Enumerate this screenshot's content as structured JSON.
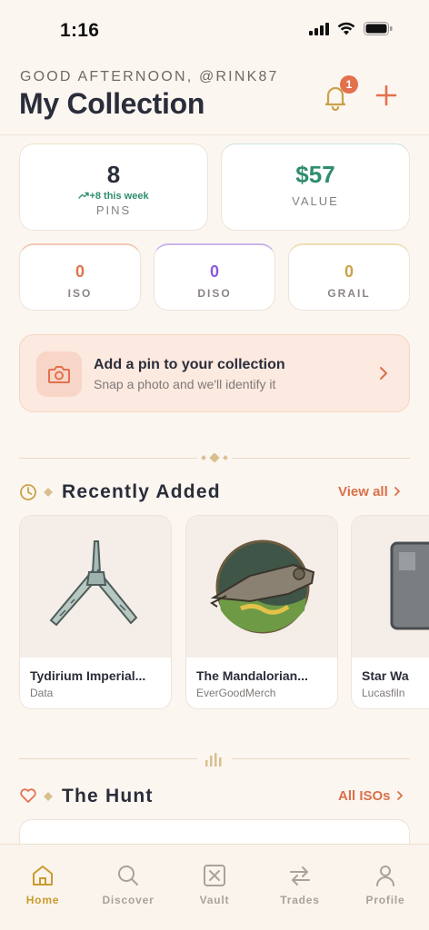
{
  "status_bar": {
    "time": "1:16"
  },
  "header": {
    "greeting": "GOOD AFTERNOON, @RINK87",
    "title": "My Collection",
    "notification_count": "1"
  },
  "stats": {
    "pins": {
      "value": "8",
      "delta": "+8 this week",
      "label": "PINS"
    },
    "value": {
      "value": "$57",
      "label": "VALUE"
    },
    "iso": {
      "value": "0",
      "label": "ISO",
      "color": "#E2714E"
    },
    "diso": {
      "value": "0",
      "label": "DISO",
      "color": "#8B5BDB"
    },
    "grail": {
      "value": "0",
      "label": "GRAIL",
      "color": "#C9A24A"
    }
  },
  "add_pin": {
    "title": "Add a pin to your collection",
    "subtitle": "Snap a photo and we'll identify it"
  },
  "recently_added": {
    "title": "Recently Added",
    "link": "View all",
    "items": [
      {
        "name": "Tydirium Imperial...",
        "maker": "Data"
      },
      {
        "name": "The Mandalorian...",
        "maker": "EverGoodMerch"
      },
      {
        "name": "Star Wa",
        "maker": "Lucasfiln"
      }
    ]
  },
  "hunt": {
    "title": "The Hunt",
    "link": "All ISOs"
  },
  "tabs": [
    {
      "label": "Home",
      "icon": "home-icon",
      "active": true
    },
    {
      "label": "Discover",
      "icon": "search-icon",
      "active": false
    },
    {
      "label": "Vault",
      "icon": "vault-icon",
      "active": false
    },
    {
      "label": "Trades",
      "icon": "trades-icon",
      "active": false
    },
    {
      "label": "Profile",
      "icon": "profile-icon",
      "active": false
    }
  ],
  "colors": {
    "accent": "#E2714E",
    "gold": "#C99B2F",
    "green": "#2F8E6D",
    "background": "#FCF6F1"
  }
}
